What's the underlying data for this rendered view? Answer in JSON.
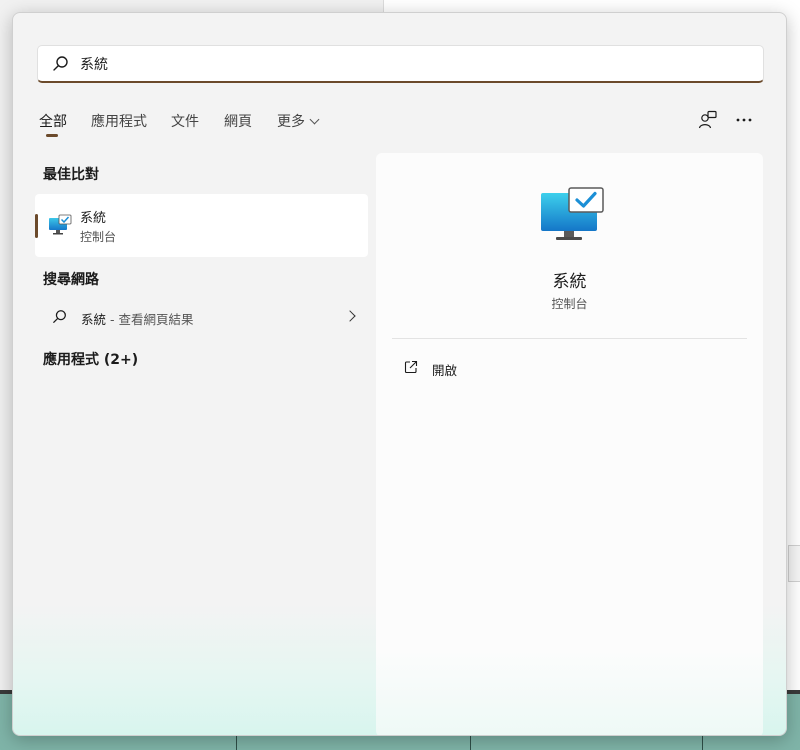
{
  "search": {
    "value": "系統",
    "icon": "search-icon"
  },
  "tabs": [
    {
      "label": "全部"
    },
    {
      "label": "應用程式"
    },
    {
      "label": "文件"
    },
    {
      "label": "網頁"
    },
    {
      "label": "更多"
    }
  ],
  "best_match": {
    "section_title": "最佳比對",
    "name": "系統",
    "sub": "控制台",
    "icon": "system-monitor-icon"
  },
  "web_search": {
    "section_title": "搜尋網路",
    "query": "系統",
    "suffix": " - 查看網頁結果"
  },
  "apps": {
    "section_title": "應用程式 (2+)"
  },
  "preview": {
    "title": "系統",
    "sub": "控制台",
    "action_open": "開啟"
  },
  "colors": {
    "accent": "#6b4a2b",
    "icon_blue": "#1b8fd6"
  }
}
